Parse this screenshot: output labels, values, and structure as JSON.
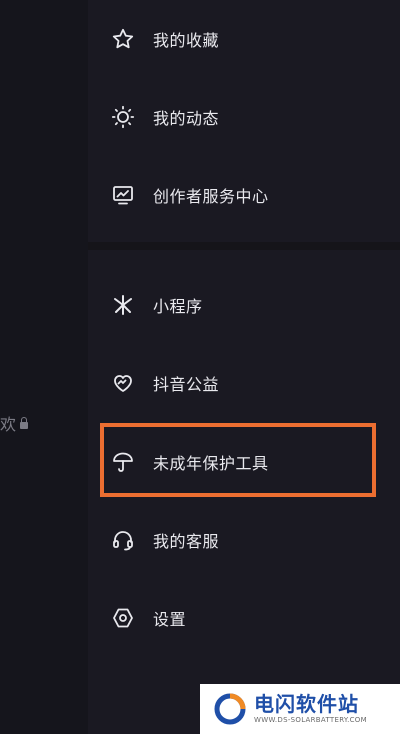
{
  "colors": {
    "background": "#14141b",
    "drawer": "#1a1922",
    "text": "#e9e9ee",
    "highlight": "#ec6e31",
    "watermark_blue": "#1f4fa8"
  },
  "left_panel": {
    "partial_text": "欢"
  },
  "menu": {
    "items": [
      {
        "label": "我的收藏",
        "icon": "star-icon"
      },
      {
        "label": "我的动态",
        "icon": "sun-icon"
      },
      {
        "label": "创作者服务中心",
        "icon": "chart-monitor-icon"
      },
      {
        "label": "小程序",
        "icon": "asterisk-icon"
      },
      {
        "label": "抖音公益",
        "icon": "heart-hands-icon"
      },
      {
        "label": "未成年保护工具",
        "icon": "umbrella-icon"
      },
      {
        "label": "我的客服",
        "icon": "headset-icon"
      },
      {
        "label": "设置",
        "icon": "hexagon-gear-icon"
      }
    ],
    "highlighted_item": "未成年保护工具"
  },
  "watermark": {
    "title": "电闪软件站",
    "subtitle": "WWW.DS-SOLARBATTERY.COM"
  }
}
